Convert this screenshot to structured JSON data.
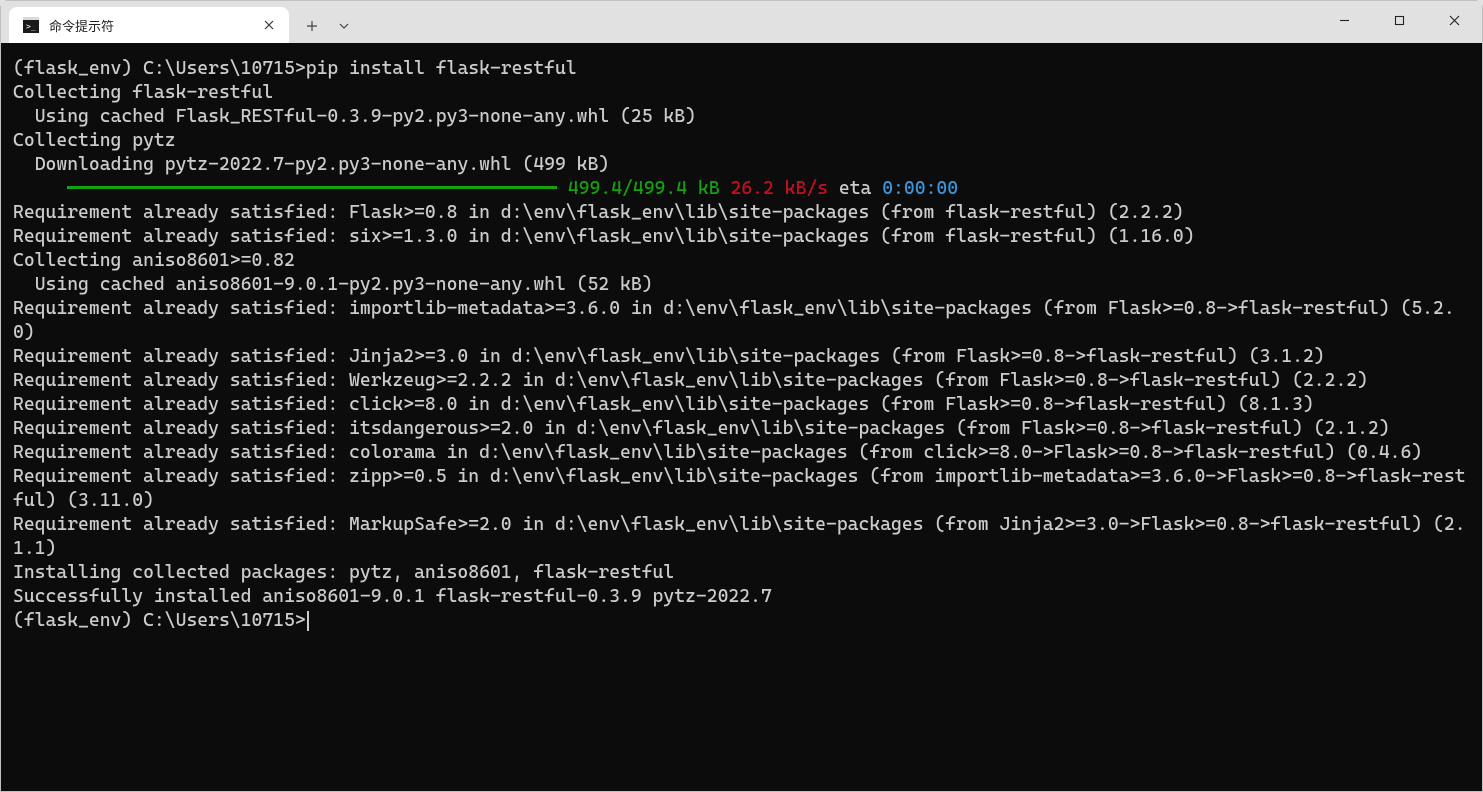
{
  "window": {
    "tab_title": "命令提示符"
  },
  "terminal": {
    "prompt1_prefix": "(flask_env) C:\\Users\\10715>",
    "prompt1_cmd": "pip install flask-restful",
    "lines_before_bar": [
      "Collecting flask-restful",
      "  Using cached Flask_RESTful-0.3.9-py2.py3-none-any.whl (25 kB)",
      "Collecting pytz",
      "  Downloading pytz-2022.7-py2.py3-none-any.whl (499 kB)"
    ],
    "bar": {
      "progress_text": " 499.4/499.4 kB",
      "speed_text": " 26.2 kB/s",
      "eta_label": " eta ",
      "eta_value": "0:00:00"
    },
    "lines_after_bar": [
      "Requirement already satisfied: Flask>=0.8 in d:\\env\\flask_env\\lib\\site-packages (from flask-restful) (2.2.2)",
      "Requirement already satisfied: six>=1.3.0 in d:\\env\\flask_env\\lib\\site-packages (from flask-restful) (1.16.0)",
      "Collecting aniso8601>=0.82",
      "  Using cached aniso8601-9.0.1-py2.py3-none-any.whl (52 kB)",
      "Requirement already satisfied: importlib-metadata>=3.6.0 in d:\\env\\flask_env\\lib\\site-packages (from Flask>=0.8->flask-restful) (5.2.0)",
      "Requirement already satisfied: Jinja2>=3.0 in d:\\env\\flask_env\\lib\\site-packages (from Flask>=0.8->flask-restful) (3.1.2)",
      "Requirement already satisfied: Werkzeug>=2.2.2 in d:\\env\\flask_env\\lib\\site-packages (from Flask>=0.8->flask-restful) (2.2.2)",
      "Requirement already satisfied: click>=8.0 in d:\\env\\flask_env\\lib\\site-packages (from Flask>=0.8->flask-restful) (8.1.3)",
      "Requirement already satisfied: itsdangerous>=2.0 in d:\\env\\flask_env\\lib\\site-packages (from Flask>=0.8->flask-restful) (2.1.2)",
      "Requirement already satisfied: colorama in d:\\env\\flask_env\\lib\\site-packages (from click>=8.0->Flask>=0.8->flask-restful) (0.4.6)",
      "Requirement already satisfied: zipp>=0.5 in d:\\env\\flask_env\\lib\\site-packages (from importlib-metadata>=3.6.0->Flask>=0.8->flask-restful) (3.11.0)",
      "Requirement already satisfied: MarkupSafe>=2.0 in d:\\env\\flask_env\\lib\\site-packages (from Jinja2>=3.0->Flask>=0.8->flask-restful) (2.1.1)",
      "Installing collected packages: pytz, aniso8601, flask-restful",
      "Successfully installed aniso8601-9.0.1 flask-restful-0.3.9 pytz-2022.7",
      ""
    ],
    "prompt2": "(flask_env) C:\\Users\\10715>"
  }
}
